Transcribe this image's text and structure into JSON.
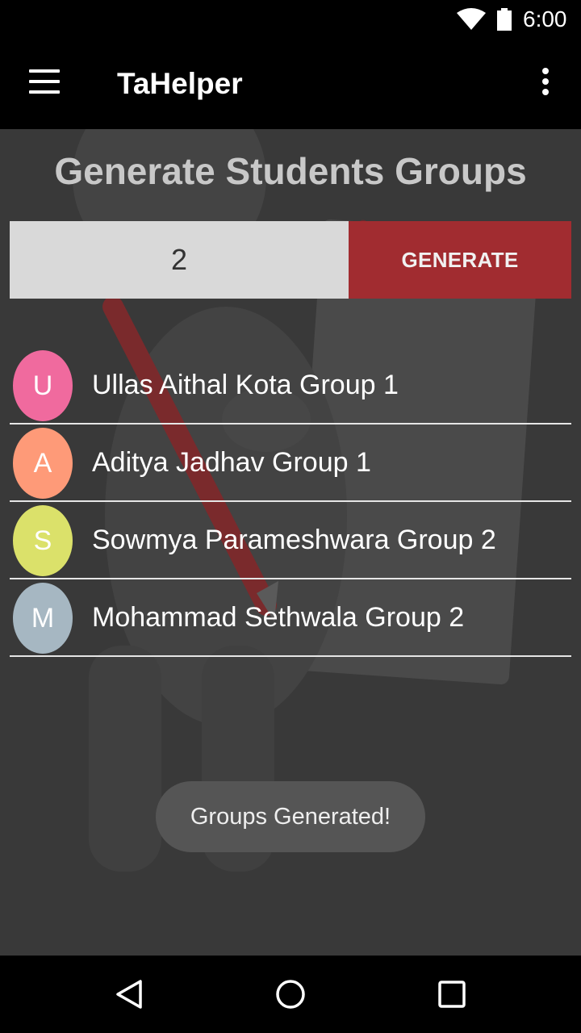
{
  "status_bar": {
    "time": "6:00",
    "icons": [
      "wifi-icon",
      "battery-icon"
    ]
  },
  "app_bar": {
    "title": "TaHelper",
    "menu_icon": "hamburger-menu-icon",
    "overflow_icon": "more-vert-icon"
  },
  "main": {
    "heading": "Generate Students Groups",
    "group_count_value": "2",
    "generate_label": "GENERATE",
    "students": [
      {
        "initial": "U",
        "label": "Ullas Aithal Kota Group 1",
        "color": "#f06a9e"
      },
      {
        "initial": "A",
        "label": "Aditya Jadhav Group 1",
        "color": "#fe9a78"
      },
      {
        "initial": "S",
        "label": "Sowmya Parameshwara Group 2",
        "color": "#dbe16a"
      },
      {
        "initial": "M",
        "label": "Mohammad Sethwala Group 2",
        "color": "#a6b7c2"
      }
    ]
  },
  "toast": {
    "message": "Groups Generated!"
  },
  "nav_bar": {
    "icons": [
      "back-icon",
      "home-icon",
      "recents-icon"
    ]
  },
  "colors": {
    "accent_button": "#a12c30",
    "input_background": "#d9d9d9",
    "content_background": "#393939"
  }
}
